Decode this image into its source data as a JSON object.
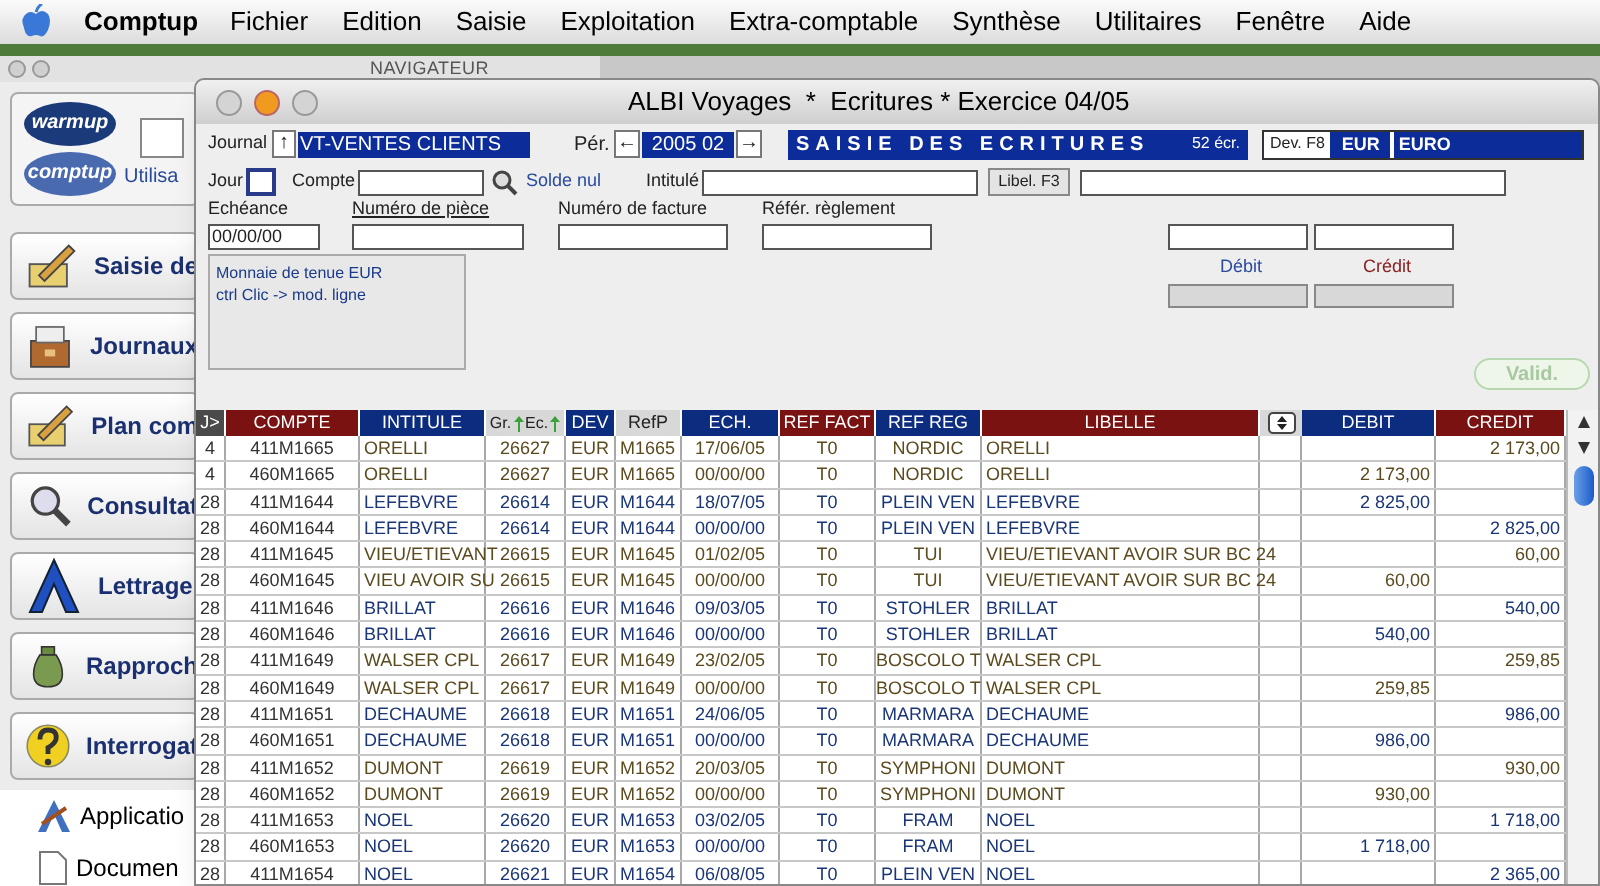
{
  "menu_bar": {
    "app": "Comptup",
    "items": [
      "Fichier",
      "Edition",
      "Saisie",
      "Exploitation",
      "Extra-comptable",
      "Synthèse",
      "Utilitaires",
      "Fenêtre",
      "Aide"
    ]
  },
  "navigator": {
    "title": "NAVIGATEUR",
    "logos": [
      "warmup",
      "comptup"
    ],
    "user_label": "Utilisa",
    "items": [
      {
        "label": "Saisie de"
      },
      {
        "label": "Journaux"
      },
      {
        "label": "Plan com"
      },
      {
        "label": "Consultat"
      },
      {
        "label": "Lettrage"
      },
      {
        "label": "Rapproch"
      },
      {
        "label": "Interrogat"
      }
    ],
    "files": [
      {
        "label": "Applicatio"
      },
      {
        "label": "Documen"
      }
    ]
  },
  "window": {
    "title": "ALBI Voyages  *  Ecritures * Exercice 04/05",
    "journal": {
      "label": "Journal",
      "arrow": "↑",
      "value": "VT-VENTES CLIENTS"
    },
    "periode": {
      "label": "Pér.",
      "prev": "←",
      "value": "2005 02",
      "next": "→"
    },
    "banner": {
      "title": "SAISIE DES ECRITURES",
      "count": "52 écr."
    },
    "devise": {
      "label": "Dev. F8",
      "code": "EUR",
      "name": "EURO"
    },
    "jour_label": "Jour",
    "compte_label": "Compte",
    "solde": "Solde nul",
    "intitule_label": "Intitulé",
    "libel_button": "Libel. F3",
    "field_labels": [
      {
        "label": "Echéance",
        "underlined": false
      },
      {
        "label": "Numéro de pièce",
        "underlined": true
      },
      {
        "label": "Numéro de facture",
        "underlined": false
      },
      {
        "label": "Référ. règlement",
        "underlined": false
      }
    ],
    "echeance_value": "00/00/00",
    "debit_label": "Débit",
    "credit_label": "Crédit",
    "info": [
      "Monnaie de tenue EUR",
      "ctrl Clic -> mod. ligne"
    ],
    "valid_button": {
      "label": "Valid.",
      "disabled": true
    }
  },
  "table": {
    "columns": [
      {
        "label": "J>",
        "kind": "text",
        "color": "#4a4a4a"
      },
      {
        "label": "COMPTE",
        "kind": "text",
        "color": "#7a1212"
      },
      {
        "label": "INTITULE",
        "kind": "text",
        "color": "#0c2c80"
      },
      {
        "labels": [
          "Gr.",
          "Ec."
        ],
        "kind": "pair",
        "color": "#d8d8d8"
      },
      {
        "label": "DEV",
        "kind": "text",
        "color": "#0c2c80"
      },
      {
        "label": "RefP",
        "kind": "text",
        "color": "#d8d8d8"
      },
      {
        "label": "ECH.",
        "kind": "text",
        "color": "#0c2c80"
      },
      {
        "label": "REF FACT",
        "kind": "text",
        "color": "#7a1212"
      },
      {
        "label": "REF REG",
        "kind": "text",
        "color": "#0c2c80"
      },
      {
        "label": "LIBELLE",
        "kind": "text",
        "color": "#7a1212"
      },
      {
        "kind": "sort",
        "color": "#d8d8d8"
      },
      {
        "label": "DEBIT",
        "kind": "text",
        "color": "#0c2c80"
      },
      {
        "label": "CREDIT",
        "kind": "text",
        "color": "#7a1212"
      }
    ],
    "rows": [
      {
        "color": "#5a4a1e",
        "cells": [
          "4",
          "411M1665",
          "ORELLI",
          "26627",
          "EUR",
          "M1665",
          "17/06/05",
          "T0",
          "NORDIC",
          "ORELLI",
          "",
          "2 173,00"
        ]
      },
      {
        "color": "#5a4a1e",
        "cells": [
          "4",
          "460M1665",
          "ORELLI",
          "26627",
          "EUR",
          "M1665",
          "00/00/00",
          "T0",
          "NORDIC",
          "ORELLI",
          "2 173,00",
          ""
        ]
      },
      {
        "color": "#1a3578",
        "cells": [
          "28",
          "411M1644",
          "LEFEBVRE",
          "26614",
          "EUR",
          "M1644",
          "18/07/05",
          "T0",
          "PLEIN VEN",
          "LEFEBVRE",
          "2 825,00",
          ""
        ]
      },
      {
        "color": "#1a3578",
        "cells": [
          "28",
          "460M1644",
          "LEFEBVRE",
          "26614",
          "EUR",
          "M1644",
          "00/00/00",
          "T0",
          "PLEIN VEN",
          "LEFEBVRE",
          "",
          "2 825,00"
        ]
      },
      {
        "color": "#5a4a1e",
        "cells": [
          "28",
          "411M1645",
          "VIEU/ETIEVANT",
          "26615",
          "EUR",
          "M1645",
          "01/02/05",
          "T0",
          "TUI",
          "VIEU/ETIEVANT AVOIR SUR BC 24",
          "",
          "60,00"
        ]
      },
      {
        "color": "#5a4a1e",
        "cells": [
          "28",
          "460M1645",
          "VIEU AVOIR SU",
          "26615",
          "EUR",
          "M1645",
          "00/00/00",
          "T0",
          "TUI",
          "VIEU/ETIEVANT AVOIR SUR BC 24",
          "60,00",
          ""
        ]
      },
      {
        "color": "#1a3578",
        "cells": [
          "28",
          "411M1646",
          "BRILLAT",
          "26616",
          "EUR",
          "M1646",
          "09/03/05",
          "T0",
          "STOHLER",
          "BRILLAT",
          "",
          "540,00"
        ]
      },
      {
        "color": "#1a3578",
        "cells": [
          "28",
          "460M1646",
          "BRILLAT",
          "26616",
          "EUR",
          "M1646",
          "00/00/00",
          "T0",
          "STOHLER",
          "BRILLAT",
          "540,00",
          ""
        ]
      },
      {
        "color": "#5a4a1e",
        "cells": [
          "28",
          "411M1649",
          "WALSER CPL",
          "26617",
          "EUR",
          "M1649",
          "23/02/05",
          "T0",
          "BOSCOLO T",
          "WALSER CPL",
          "",
          "259,85"
        ]
      },
      {
        "color": "#5a4a1e",
        "cells": [
          "28",
          "460M1649",
          "WALSER CPL",
          "26617",
          "EUR",
          "M1649",
          "00/00/00",
          "T0",
          "BOSCOLO T",
          "WALSER CPL",
          "259,85",
          ""
        ]
      },
      {
        "color": "#1a3578",
        "cells": [
          "28",
          "411M1651",
          "DECHAUME",
          "26618",
          "EUR",
          "M1651",
          "24/06/05",
          "T0",
          "MARMARA",
          "DECHAUME",
          "",
          "986,00"
        ]
      },
      {
        "color": "#1a3578",
        "cells": [
          "28",
          "460M1651",
          "DECHAUME",
          "26618",
          "EUR",
          "M1651",
          "00/00/00",
          "T0",
          "MARMARA",
          "DECHAUME",
          "986,00",
          ""
        ]
      },
      {
        "color": "#5a4a1e",
        "cells": [
          "28",
          "411M1652",
          "DUMONT",
          "26619",
          "EUR",
          "M1652",
          "20/03/05",
          "T0",
          "SYMPHONI",
          "DUMONT",
          "",
          "930,00"
        ]
      },
      {
        "color": "#5a4a1e",
        "cells": [
          "28",
          "460M1652",
          "DUMONT",
          "26619",
          "EUR",
          "M1652",
          "00/00/00",
          "T0",
          "SYMPHONI",
          "DUMONT",
          "930,00",
          ""
        ]
      },
      {
        "color": "#1a3578",
        "cells": [
          "28",
          "411M1653",
          "NOEL",
          "26620",
          "EUR",
          "M1653",
          "03/02/05",
          "T0",
          "FRAM",
          "NOEL",
          "",
          "1 718,00"
        ]
      },
      {
        "color": "#1a3578",
        "cells": [
          "28",
          "460M1653",
          "NOEL",
          "26620",
          "EUR",
          "M1653",
          "00/00/00",
          "T0",
          "FRAM",
          "NOEL",
          "1 718,00",
          ""
        ]
      },
      {
        "color": "#1a3578",
        "cells": [
          "28",
          "411M1654",
          "NOEL",
          "26621",
          "EUR",
          "M1654",
          "06/08/05",
          "T0",
          "PLEIN VEN",
          "NOEL",
          "",
          "2 365,00"
        ]
      }
    ]
  }
}
